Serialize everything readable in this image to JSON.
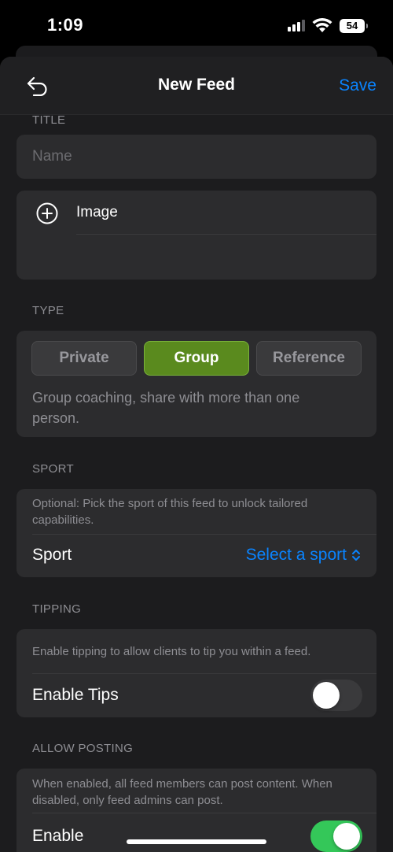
{
  "status_bar": {
    "time": "1:09",
    "battery": "54"
  },
  "nav": {
    "title": "New Feed",
    "save_label": "Save"
  },
  "title_section": {
    "header": "TITLE",
    "name_placeholder": "Name",
    "image_label": "Image"
  },
  "type_section": {
    "header": "TYPE",
    "options": [
      "Private",
      "Group",
      "Reference"
    ],
    "selected": "Group",
    "description": "Group coaching, share with more than one person."
  },
  "sport_section": {
    "header": "SPORT",
    "helper": "Optional: Pick the sport of this feed to unlock tailored capabilities.",
    "label": "Sport",
    "picker_value": "Select a sport"
  },
  "tipping_section": {
    "header": "TIPPING",
    "helper": "Enable tipping to allow clients to tip you within a feed.",
    "label": "Enable Tips",
    "enabled": false
  },
  "posting_section": {
    "header": "ALLOW POSTING",
    "helper": "When enabled, all feed members can post content. When disabled, only feed admins can post.",
    "label": "Enable",
    "enabled": true
  },
  "colors": {
    "accent": "#0a84ff",
    "selected_segment": "#5a8a1e",
    "toggle_on": "#34c759"
  }
}
